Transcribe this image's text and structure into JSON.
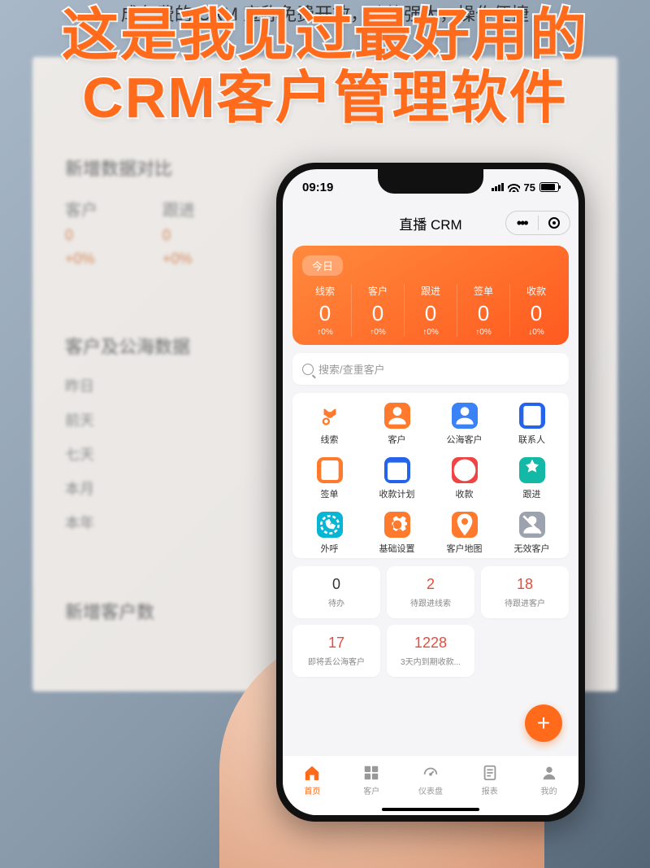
{
  "caption": "成免费的 CRM 宣称免费开放，功能强大，操作便捷",
  "headline_line1": "这是我见过最好用的",
  "headline_line2": "CRM客户管理软件",
  "bg": {
    "section1": "新增数据对比",
    "cols": [
      "客户",
      "跟进"
    ],
    "zeros": [
      "0",
      "0"
    ],
    "pcts": [
      "+0%",
      "+0%"
    ],
    "section2": "客户及公海数据",
    "items": [
      "昨日",
      "前天",
      "七天",
      "本月",
      "本年"
    ],
    "section3": "新增客户数"
  },
  "status": {
    "time": "09:19",
    "battery": "75"
  },
  "mp_title": "直播 CRM",
  "today": {
    "chip": "今日",
    "stats": [
      {
        "label": "线索",
        "value": "0",
        "delta": "0%",
        "dir": "up"
      },
      {
        "label": "客户",
        "value": "0",
        "delta": "0%",
        "dir": "up"
      },
      {
        "label": "跟进",
        "value": "0",
        "delta": "0%",
        "dir": "up"
      },
      {
        "label": "签单",
        "value": "0",
        "delta": "0%",
        "dir": "up"
      },
      {
        "label": "收款",
        "value": "0",
        "delta": "0%",
        "dir": "down"
      }
    ]
  },
  "search_placeholder": "搜索/查重客户",
  "modules": [
    {
      "label": "线索",
      "icon": "clue",
      "color": "c-orange"
    },
    {
      "label": "客户",
      "icon": "person",
      "color": "c-orange"
    },
    {
      "label": "公海客户",
      "icon": "person",
      "color": "c-blue"
    },
    {
      "label": "联系人",
      "icon": "contact",
      "color": "c-dblue"
    },
    {
      "label": "签单",
      "icon": "check",
      "color": "c-orange"
    },
    {
      "label": "收款计划",
      "icon": "calendar",
      "color": "c-dblue"
    },
    {
      "label": "收款",
      "icon": "money",
      "color": "c-red"
    },
    {
      "label": "跟进",
      "icon": "follow",
      "color": "c-teal"
    },
    {
      "label": "外呼",
      "icon": "call",
      "color": "c-cyan"
    },
    {
      "label": "基础设置",
      "icon": "gear",
      "color": "c-orange"
    },
    {
      "label": "客户地图",
      "icon": "pin",
      "color": "c-orange"
    },
    {
      "label": "无效客户",
      "icon": "invalid",
      "color": "c-grey"
    }
  ],
  "cards": [
    {
      "value": "0",
      "label": "待办",
      "color": "v-black"
    },
    {
      "value": "2",
      "label": "待跟进线索",
      "color": "v-red"
    },
    {
      "value": "18",
      "label": "待跟进客户",
      "color": "v-red"
    },
    {
      "value": "17",
      "label": "即将丢公海客户",
      "color": "v-red"
    },
    {
      "value": "1228",
      "label": "3天内到期收款...",
      "color": "v-red"
    }
  ],
  "tabs": [
    {
      "label": "首页",
      "icon": "home",
      "active": true
    },
    {
      "label": "客户",
      "icon": "grid",
      "active": false
    },
    {
      "label": "仪表盘",
      "icon": "dash",
      "active": false
    },
    {
      "label": "报表",
      "icon": "doc",
      "active": false
    },
    {
      "label": "我的",
      "icon": "me",
      "active": false
    }
  ]
}
